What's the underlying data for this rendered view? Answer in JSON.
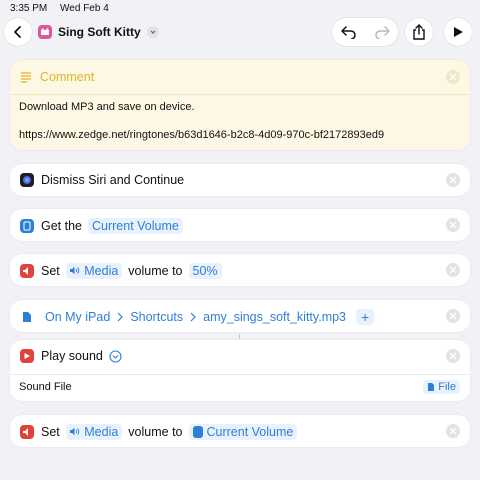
{
  "status_bar": {
    "time": "3:35 PM",
    "date": "Wed Feb 4"
  },
  "toolbar": {
    "back_icon": "chevron-left-icon",
    "title": "Sing Soft Kitty",
    "title_menu_icon": "chevron-down-icon",
    "undo_icon": "undo-icon",
    "redo_icon": "redo-icon",
    "share_icon": "share-icon",
    "play_icon": "play-icon"
  },
  "comment": {
    "title": "Comment",
    "line1": "Download MP3 and save on device.",
    "line2": "https://www.zedge.net/ringtones/b63d1646-b2c8-4d09-970c-bf2172893ed9"
  },
  "actions": {
    "dismiss": {
      "label": "Dismiss Siri and Continue"
    },
    "get_volume": {
      "prefix": "Get the",
      "token": "Current Volume"
    },
    "set_volume_1": {
      "prefix": "Set",
      "token_media": "Media",
      "middle": "volume to",
      "value": "50%"
    },
    "file_path": {
      "segment1": "On My iPad",
      "segment2": "Shortcuts",
      "segment3": "amy_sings_soft_kitty.mp3",
      "add": "+"
    },
    "play_sound": {
      "label": "Play sound",
      "param_label": "Sound File",
      "param_value": "File"
    },
    "set_volume_2": {
      "prefix": "Set",
      "token_media": "Media",
      "middle": "volume to",
      "token_current": "Current Volume"
    }
  },
  "colors": {
    "accent": "#2f7fd6",
    "comment_yellow": "#e0b32a",
    "set_volume_red": "#e0433c",
    "get_volume_blue": "#2f7fd6",
    "play_red": "#e0433c"
  }
}
